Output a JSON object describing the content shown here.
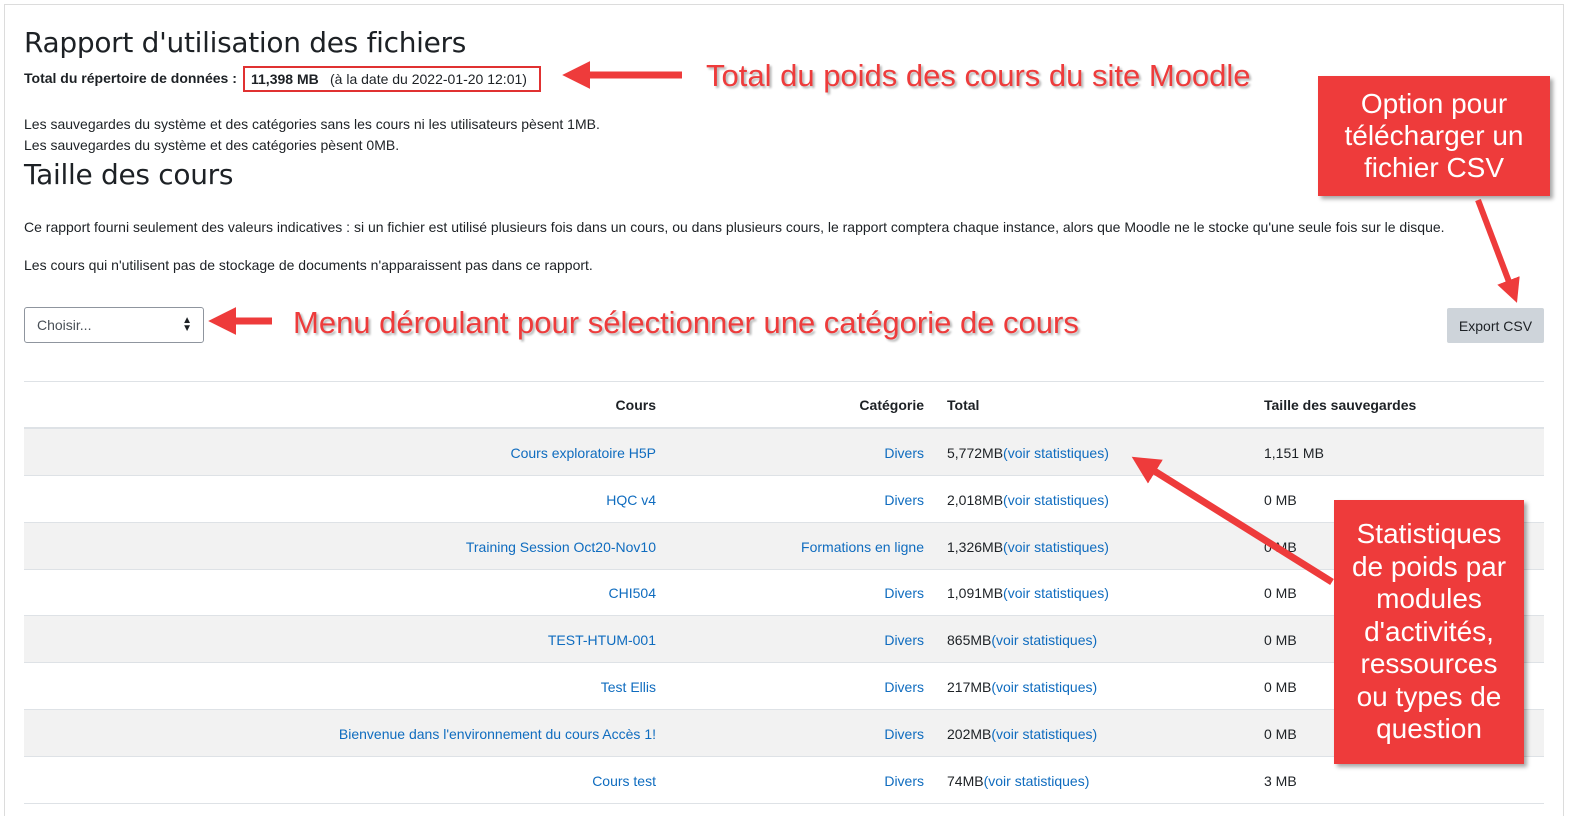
{
  "report": {
    "title": "Rapport d'utilisation des fichiers",
    "total_label": "Total du répertoire de données :",
    "total_value": "11,398 MB",
    "total_date": "(à la date du 2022-01-20 12:01)",
    "backup_info_1": "Les sauvegardes du système et des catégories sans les cours ni les utilisateurs pèsent 1MB.",
    "backup_info_2": "Les sauvegardes du système et des catégories pèsent 0MB.",
    "section_title": "Taille des cours",
    "description_1": "Ce rapport fourni seulement des valeurs indicatives : si un fichier est utilisé plusieurs fois dans un cours, ou dans plusieurs cours, le rapport comptera chaque instance, alors que Moodle ne le stocke qu'une seule fois sur le disque.",
    "description_2": "Les cours qui n'utilisent pas de stockage de documents n'apparaissent pas dans ce rapport."
  },
  "filter": {
    "selected": "Choisir..."
  },
  "export_button": "Export CSV",
  "table": {
    "headers": {
      "course": "Cours",
      "category": "Catégorie",
      "total": "Total",
      "backup": "Taille des sauvegardes"
    },
    "rows": [
      {
        "course": "Cours exploratoire H5P",
        "category": "Divers",
        "total": "5,772MB",
        "stats_link": "(voir statistiques)",
        "backup": "1,151 MB"
      },
      {
        "course": "HQC v4",
        "category": "Divers",
        "total": "2,018MB",
        "stats_link": "(voir statistiques)",
        "backup": "0 MB"
      },
      {
        "course": "Training Session Oct20-Nov10",
        "category": "Formations en ligne",
        "total": "1,326MB",
        "stats_link": "(voir statistiques)",
        "backup": "0 MB"
      },
      {
        "course": "CHI504",
        "category": "Divers",
        "total": "1,091MB",
        "stats_link": "(voir statistiques)",
        "backup": "0 MB"
      },
      {
        "course": "TEST-HTUM-001",
        "category": "Divers",
        "total": "865MB",
        "stats_link": "(voir statistiques)",
        "backup": "0 MB"
      },
      {
        "course": "Test Ellis",
        "category": "Divers",
        "total": "217MB",
        "stats_link": "(voir statistiques)",
        "backup": "0 MB"
      },
      {
        "course": "Bienvenue dans l'environnement du cours Accès 1!",
        "category": "Divers",
        "total": "202MB",
        "stats_link": "(voir statistiques)",
        "backup": "0 MB"
      },
      {
        "course": "Cours test",
        "category": "Divers",
        "total": "74MB",
        "stats_link": "(voir statistiques)",
        "backup": "3 MB"
      }
    ]
  },
  "annotations": {
    "total_note": "Total du poids des cours du site Moodle",
    "menu_note": "Menu déroulant pour sélectionner une catégorie de cours",
    "csv_callout": [
      "Option pour",
      "télécharger un",
      "fichier CSV"
    ],
    "stats_callout": [
      "Statistiques",
      "de poids par",
      "modules",
      "d'activités,",
      "ressources",
      "ou types de",
      "question"
    ]
  },
  "colors": {
    "annotation_red": "#ee3b3b",
    "link_blue": "#0f6cbf",
    "button_gray": "#ced4da"
  }
}
